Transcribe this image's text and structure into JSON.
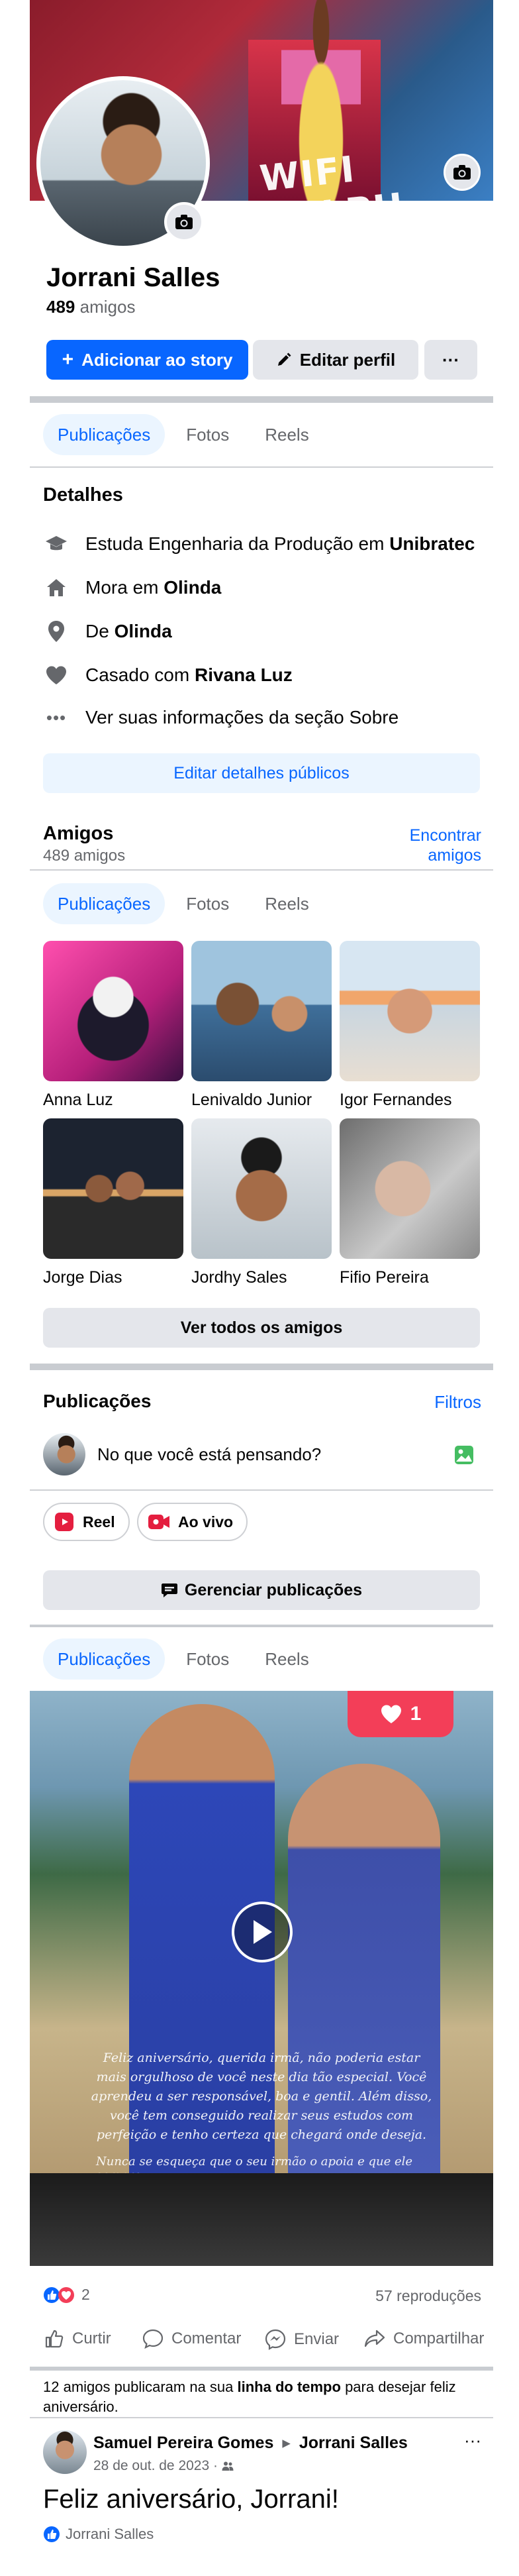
{
  "profile": {
    "name": "Jorrani Salles",
    "friends_number": "489",
    "friends_word": "amigos",
    "cover_text": "WIFI RALPH"
  },
  "buttons": {
    "add_story": "Adicionar ao story",
    "edit_profile": "Editar perfil",
    "more": "···"
  },
  "tabs": [
    "Publicações",
    "Fotos",
    "Reels"
  ],
  "details": {
    "title": "Detalhes",
    "study_prefix": "Estuda Engenharia da Produção em ",
    "study_place": "Unibratec",
    "lives_prefix": "Mora em ",
    "lives_place": "Olinda",
    "from_prefix": "De ",
    "from_place": "Olinda",
    "married_prefix": "Casado com ",
    "married_name": "Rivana Luz",
    "see_about": "Ver suas informações da seção Sobre",
    "edit_button": "Editar detalhes públicos"
  },
  "friends": {
    "title": "Amigos",
    "count": "489 amigos",
    "find_line1": "Encontrar",
    "find_line2": "amigos",
    "list": [
      "Anna Luz",
      "Lenivaldo Junior",
      "Igor Fernandes",
      "Jorge Dias",
      "Jordhy Sales",
      "Fifio Pereira"
    ],
    "see_all": "Ver todos os amigos"
  },
  "posts": {
    "title": "Publicações",
    "filters": "Filtros",
    "composer_placeholder": "No que você está pensando?",
    "reel_chip": "Reel",
    "live_chip": "Ao vivo",
    "manage": "Gerenciar publicações"
  },
  "video_post": {
    "notification_count": "1",
    "caption": "Feliz aniversário, querida irmã, não poderia estar mais orgulhoso de você neste dia tão especial. Você aprendeu a ser responsável, boa e gentil. Além disso, você tem conseguido realizar seus estudos com perfeição e tenho certeza que chegará onde deseja.",
    "caption2": "Nunca se esqueça que o seu irmão o apoia e que ele sempre",
    "reactions_count": "2",
    "views": "57 reproduções",
    "actions": [
      "Curtir",
      "Comentar",
      "Enviar",
      "Compartilhar"
    ]
  },
  "timeline_note": {
    "prefix": "12 amigos publicaram na sua ",
    "link": "linha do tempo",
    "suffix": " para desejar feliz aniversário."
  },
  "birthday_post": {
    "author": "Samuel Pereira Gomes",
    "arrow": "▸",
    "target": "Jorrani Salles",
    "date": "28 de out. de 2023 ·",
    "text": "Feliz aniversário, Jorrani!",
    "liker": "Jorrani Salles",
    "menu": "···"
  },
  "colors": {
    "accent": "#0866ff",
    "love": "#f33e58",
    "page_bg": "#ffffff"
  }
}
